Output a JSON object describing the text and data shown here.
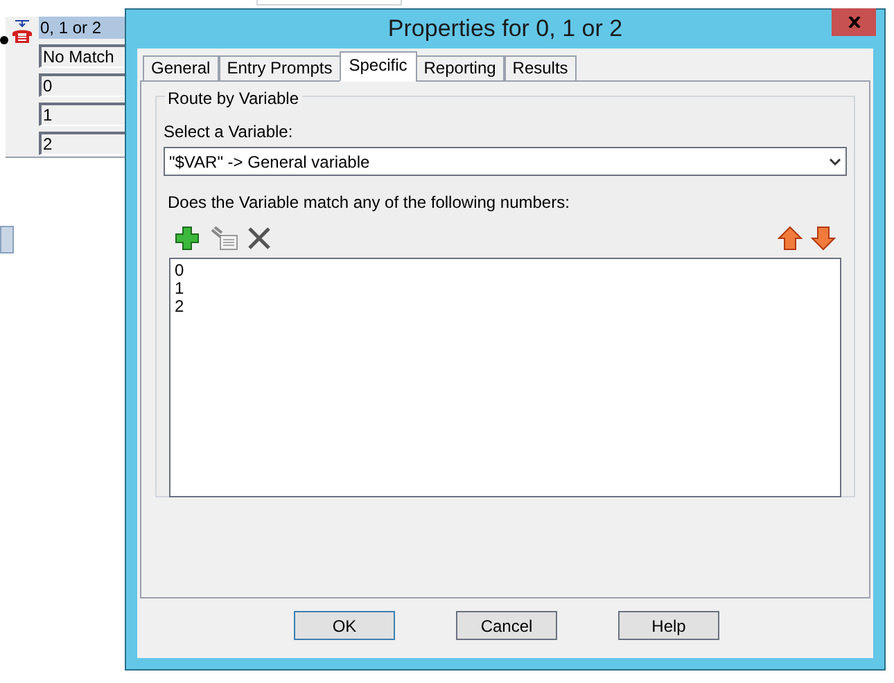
{
  "diagram_node": {
    "title": "0, 1 or 2",
    "outputs": [
      "No Match",
      "0",
      "1",
      "2"
    ]
  },
  "dialog": {
    "title": "Properties for 0, 1 or 2",
    "tabs": [
      {
        "label": "General",
        "selected": false
      },
      {
        "label": "Entry Prompts",
        "selected": false
      },
      {
        "label": "Specific",
        "selected": true
      },
      {
        "label": "Reporting",
        "selected": false
      },
      {
        "label": "Results",
        "selected": false
      }
    ],
    "group_title": "Route by Variable",
    "variable_label": "Select a Variable:",
    "variable_value": "\"$VAR\" -> General variable",
    "numbers_label": "Does the Variable match any of the following numbers:",
    "numbers": [
      "0",
      "1",
      "2"
    ],
    "buttons": [
      {
        "label": "OK",
        "default": true
      },
      {
        "label": "Cancel",
        "default": false
      },
      {
        "label": "Help",
        "default": false
      }
    ]
  }
}
